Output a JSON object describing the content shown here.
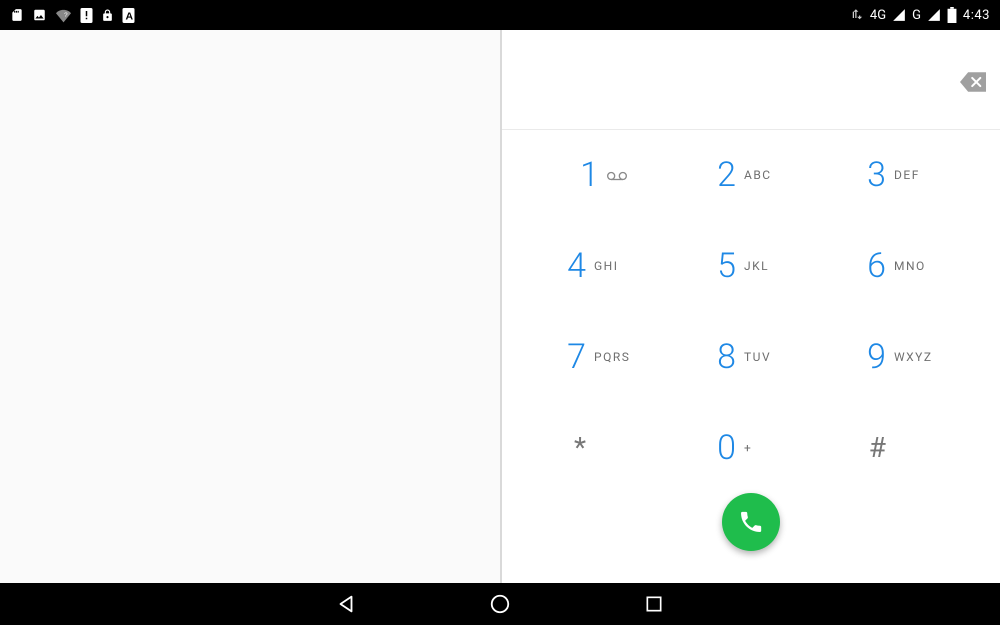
{
  "status": {
    "time": "4:43",
    "network1_label": "4G",
    "network2_label": "G"
  },
  "dialpad": {
    "keys": [
      {
        "digit": "1",
        "letters": ""
      },
      {
        "digit": "2",
        "letters": "ABC"
      },
      {
        "digit": "3",
        "letters": "DEF"
      },
      {
        "digit": "4",
        "letters": "GHI"
      },
      {
        "digit": "5",
        "letters": "JKL"
      },
      {
        "digit": "6",
        "letters": "MNO"
      },
      {
        "digit": "7",
        "letters": "PQRS"
      },
      {
        "digit": "8",
        "letters": "TUV"
      },
      {
        "digit": "9",
        "letters": "WXYZ"
      },
      {
        "digit": "*",
        "letters": ""
      },
      {
        "digit": "0",
        "letters": "+"
      },
      {
        "digit": "#",
        "letters": ""
      }
    ]
  }
}
